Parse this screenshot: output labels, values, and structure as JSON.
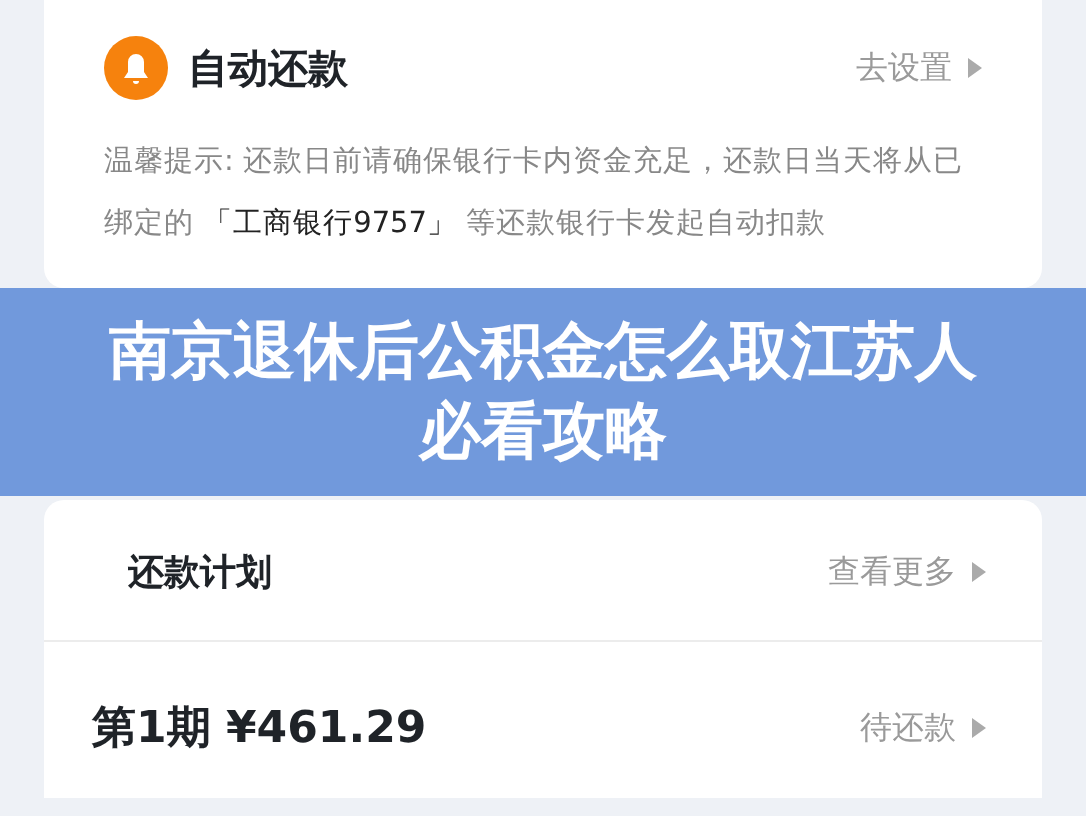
{
  "auto_repay": {
    "title": "自动还款",
    "action": "去设置",
    "tip": "温馨提示: 还款日前请确保银行卡内资金充足，还款日当天将从已绑定的 **「工商银行9757」** 等还款银行卡发起自动扣款"
  },
  "banner": {
    "title": "南京退休后公积金怎么取江苏人必看攻略"
  },
  "plan": {
    "title": "还款计划",
    "action": "查看更多",
    "installments": [
      {
        "period": "第1期",
        "amount": "¥461.29",
        "status": "待还款"
      }
    ]
  }
}
